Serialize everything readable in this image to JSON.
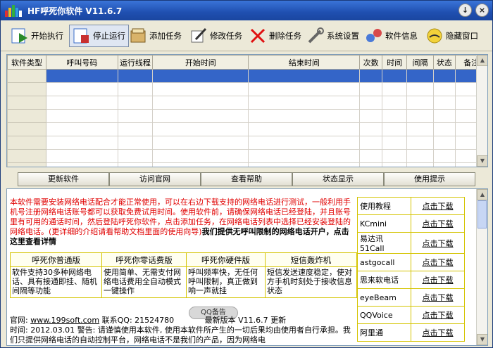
{
  "window": {
    "title": "HF呼死你软件 V11.6.7"
  },
  "titlebar_buttons": {
    "minimize": "↓",
    "close": "×"
  },
  "toolbar": [
    {
      "name": "start-button",
      "icon": "play-icon",
      "label": "开始执行"
    },
    {
      "name": "stop-button",
      "icon": "stop-icon",
      "label": "停止运行",
      "pressed": true
    },
    {
      "name": "add-task-button",
      "icon": "add-icon",
      "label": "添加任务"
    },
    {
      "name": "edit-task-button",
      "icon": "edit-icon",
      "label": "修改任务"
    },
    {
      "name": "delete-task-button",
      "icon": "delete-icon",
      "label": "删除任务"
    },
    {
      "name": "settings-button",
      "icon": "wrench-icon",
      "label": "系统设置"
    },
    {
      "name": "info-button",
      "icon": "info-icon",
      "label": "软件信息"
    },
    {
      "name": "hide-window-button",
      "icon": "hide-icon",
      "label": "隐藏窗口"
    }
  ],
  "grid": {
    "columns": [
      "软件类型",
      "呼叫号码",
      "运行线程",
      "开始时间",
      "结束时间",
      "次数",
      "时间",
      "间隔",
      "状态",
      "备注"
    ],
    "rows": 8,
    "selected_row": 0
  },
  "bottom_buttons": [
    "更新软件",
    "访问官网",
    "查看帮助",
    "状态显示",
    "使用提示"
  ],
  "info": {
    "intro_red": "本软件需要安装网络电话配合才能正常使用，可以在右边下载支持的网络电话进行测试，一般利用手机号注册网络电话账号都可以获取免费试用时间。使用软件前，请确保网络电话已经登陆，并且账号里有可用的通话时间，然后登陆呼死你软件，点击添加任务，在网络电话列表中选择已经安装登陆的网络电话。(更详细的介绍请看帮助文档里面的使用向导)",
    "intro_bold": "我们提供无呼叫限制的网络电话开户，点击这里查看详情",
    "features": [
      {
        "title": "呼死你普通版",
        "desc": "软件支持30多种网络电话、具有接通即挂、随机间隔等功能"
      },
      {
        "title": "呼死你零话费版",
        "desc": "使用简单、无需支付网络电话费用全自动模式一键操作"
      },
      {
        "title": "呼死你硬件版",
        "desc": "呼叫频率快，无任何呼叫限制，真正做到响一声就挂"
      },
      {
        "title": "短信轰炸机",
        "desc": "短信发送速度稳定，使对方手机时刻处于接收信息状态"
      }
    ],
    "qq_badge": "QQ备告",
    "footer_line1_label": "官网: ",
    "footer_url": "www.199soft.com",
    "footer_qq": " 联系QQ: 21524780",
    "footer_version": "最新版本 V11.6.7 更新",
    "footer_line2": "时间: 2012.03.01 警告: 请谨慎使用本软件, 使用本软件所产生的一切后果均由使用者自行承担。我们只提供网络电话的自动控制平台，网络电话不是我们的产品，因为网络电"
  },
  "downloads": [
    {
      "name": "使用教程",
      "link": "点击下载"
    },
    {
      "name": "KCmini",
      "link": "点击下载"
    },
    {
      "name": "易达讯 51Call",
      "link": "点击下载"
    },
    {
      "name": "astgocall",
      "link": "点击下载"
    },
    {
      "name": "思来软电话",
      "link": "点击下载"
    },
    {
      "name": "eyeBeam",
      "link": "点击下载"
    },
    {
      "name": "QQVoice",
      "link": "点击下载"
    },
    {
      "name": "阿里通",
      "link": "点击下载"
    }
  ],
  "colors": {
    "titlebar": "#1f4fb0",
    "selection": "#3465c8",
    "intro_text": "#e00000",
    "frame_border": "#d4c400"
  }
}
